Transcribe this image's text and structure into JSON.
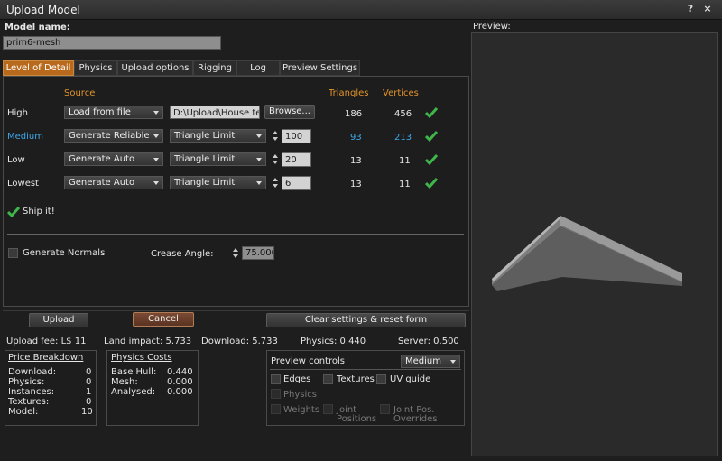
{
  "window": {
    "title": "Upload Model",
    "help": "?",
    "close": "×"
  },
  "model_name": {
    "label": "Model name:",
    "value": "prim6-mesh"
  },
  "tabs": [
    {
      "label": "Level of Detail"
    },
    {
      "label": "Physics"
    },
    {
      "label": "Upload options"
    },
    {
      "label": "Rigging"
    },
    {
      "label": "Log"
    },
    {
      "label": "Preview Settings"
    }
  ],
  "lod": {
    "headers": {
      "source": "Source",
      "triangles": "Triangles",
      "vertices": "Vertices"
    },
    "rows": [
      {
        "name": "High",
        "source": "Load from file",
        "file": "D:\\Upload\\House test",
        "browse": "Browse...",
        "triangles": "186",
        "vertices": "456"
      },
      {
        "name": "Medium",
        "source": "Generate Reliable",
        "mode": "Triangle Limit",
        "limit": "100",
        "triangles": "93",
        "vertices": "213"
      },
      {
        "name": "Low",
        "source": "Generate Auto",
        "mode": "Triangle Limit",
        "limit": "20",
        "triangles": "13",
        "vertices": "11"
      },
      {
        "name": "Lowest",
        "source": "Generate Auto",
        "mode": "Triangle Limit",
        "limit": "6",
        "triangles": "13",
        "vertices": "11"
      }
    ],
    "ship_it": "Ship it!",
    "generate_normals": "Generate Normals",
    "crease_angle_label": "Crease Angle:",
    "crease_angle_value": "75.000"
  },
  "buttons": {
    "upload": "Upload",
    "cancel": "Cancel",
    "clear": "Clear settings & reset form"
  },
  "stats": {
    "upload_fee": "Upload fee: L$ 11",
    "land_impact": "Land impact: 5.733",
    "download": "Download: 5.733",
    "physics": "Physics: 0.440",
    "server": "Server: 0.500"
  },
  "price_breakdown": {
    "title": "Price Breakdown",
    "rows": [
      {
        "label": "Download:",
        "value": "0"
      },
      {
        "label": "Physics:",
        "value": "0"
      },
      {
        "label": "Instances:",
        "value": "1"
      },
      {
        "label": "Textures:",
        "value": "0"
      },
      {
        "label": "Model:",
        "value": "10"
      }
    ]
  },
  "physics_costs": {
    "title": "Physics Costs",
    "rows": [
      {
        "label": "Base Hull:",
        "value": "0.440"
      },
      {
        "label": "Mesh:",
        "value": "0.000"
      },
      {
        "label": "Analysed:",
        "value": "0.000"
      }
    ]
  },
  "preview_controls": {
    "title": "Preview controls",
    "lod_select": "Medium",
    "edges": "Edges",
    "textures": "Textures",
    "uv_guide": "UV guide",
    "physics": "Physics",
    "weights": "Weights",
    "joint_positions_1": "Joint",
    "joint_positions_2": "Positions",
    "joint_overrides_1": "Joint Pos.",
    "joint_overrides_2": "Overrides"
  },
  "preview": {
    "label": "Preview:"
  },
  "colors": {
    "accent": "#b8691c",
    "header": "#e1932a",
    "medium": "#3ea8e8",
    "check": "#3fb54a"
  }
}
